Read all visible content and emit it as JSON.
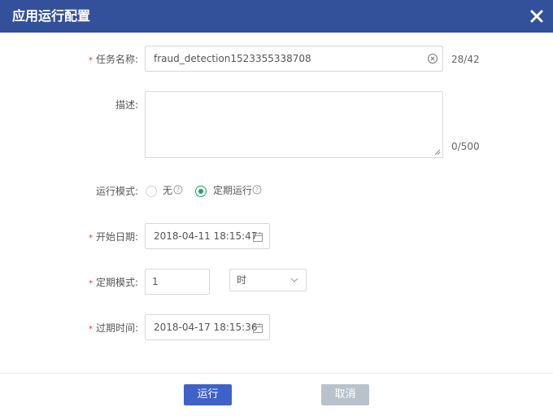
{
  "dialog": {
    "title": "应用运行配置",
    "close_icon": "close-icon"
  },
  "form": {
    "task_name": {
      "label": "任务名称:",
      "required": "*",
      "value": "fraud_detection1523355338708",
      "counter": "28/42"
    },
    "description": {
      "label": "描述:",
      "value": "",
      "counter": "0/500"
    },
    "run_mode": {
      "label": "运行模式:",
      "options": [
        {
          "label": "无",
          "checked": false
        },
        {
          "label": "定期运行",
          "checked": true
        }
      ]
    },
    "start_date": {
      "label": "开始日期:",
      "required": "*",
      "value": "2018-04-11 18:15:47"
    },
    "schedule_mode": {
      "label": "定期模式:",
      "required": "*",
      "value": "1",
      "unit": "时"
    },
    "expire_time": {
      "label": "过期时间:",
      "required": "*",
      "value": "2018-04-17 18:15:36"
    }
  },
  "footer": {
    "run_label": "运行",
    "cancel_label": "取消"
  },
  "colors": {
    "header": "#33509a",
    "primary": "#3e62c8",
    "disabled": "#b8c2cc",
    "radio_checked": "#1aa36c",
    "required": "#e0382f"
  }
}
